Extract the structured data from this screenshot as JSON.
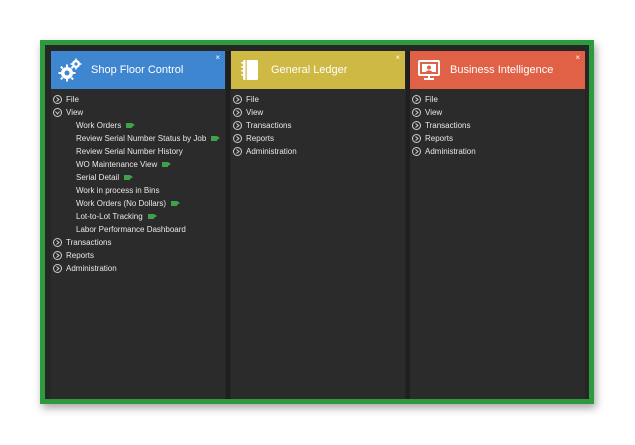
{
  "colors": {
    "frame": "#2e9a3e",
    "shop_floor_header": "#3f86d1",
    "general_ledger_header": "#cdb944",
    "business_intelligence_header": "#e06146",
    "camera_indicator": "#3fa14a"
  },
  "panels": [
    {
      "title": "Shop Floor Control",
      "icon": "gears-icon",
      "close": "×",
      "items": [
        {
          "label": "File"
        },
        {
          "label": "View",
          "children": [
            {
              "label": "Work Orders",
              "camera": true
            },
            {
              "label": "Review Serial Number Status by Job",
              "camera": true
            },
            {
              "label": "Review Serial Number History"
            },
            {
              "label": "WO Maintenance View",
              "camera": true
            },
            {
              "label": "Serial Detail",
              "camera": true
            },
            {
              "label": "Work in process in Bins"
            },
            {
              "label": "Work Orders (No Dollars)",
              "camera": true
            },
            {
              "label": "Lot-to-Lot Tracking",
              "camera": true
            },
            {
              "label": "Labor Performance Dashboard"
            }
          ]
        },
        {
          "label": "Transactions"
        },
        {
          "label": "Reports"
        },
        {
          "label": "Administration"
        }
      ]
    },
    {
      "title": "General Ledger",
      "icon": "notebook-icon",
      "close": "×",
      "items": [
        {
          "label": "File"
        },
        {
          "label": "View"
        },
        {
          "label": "Transactions"
        },
        {
          "label": "Reports"
        },
        {
          "label": "Administration"
        }
      ]
    },
    {
      "title": "Business Intelligence",
      "icon": "presentation-icon",
      "close": "×",
      "items": [
        {
          "label": "File"
        },
        {
          "label": "View"
        },
        {
          "label": "Transactions"
        },
        {
          "label": "Reports"
        },
        {
          "label": "Administration"
        }
      ]
    }
  ]
}
